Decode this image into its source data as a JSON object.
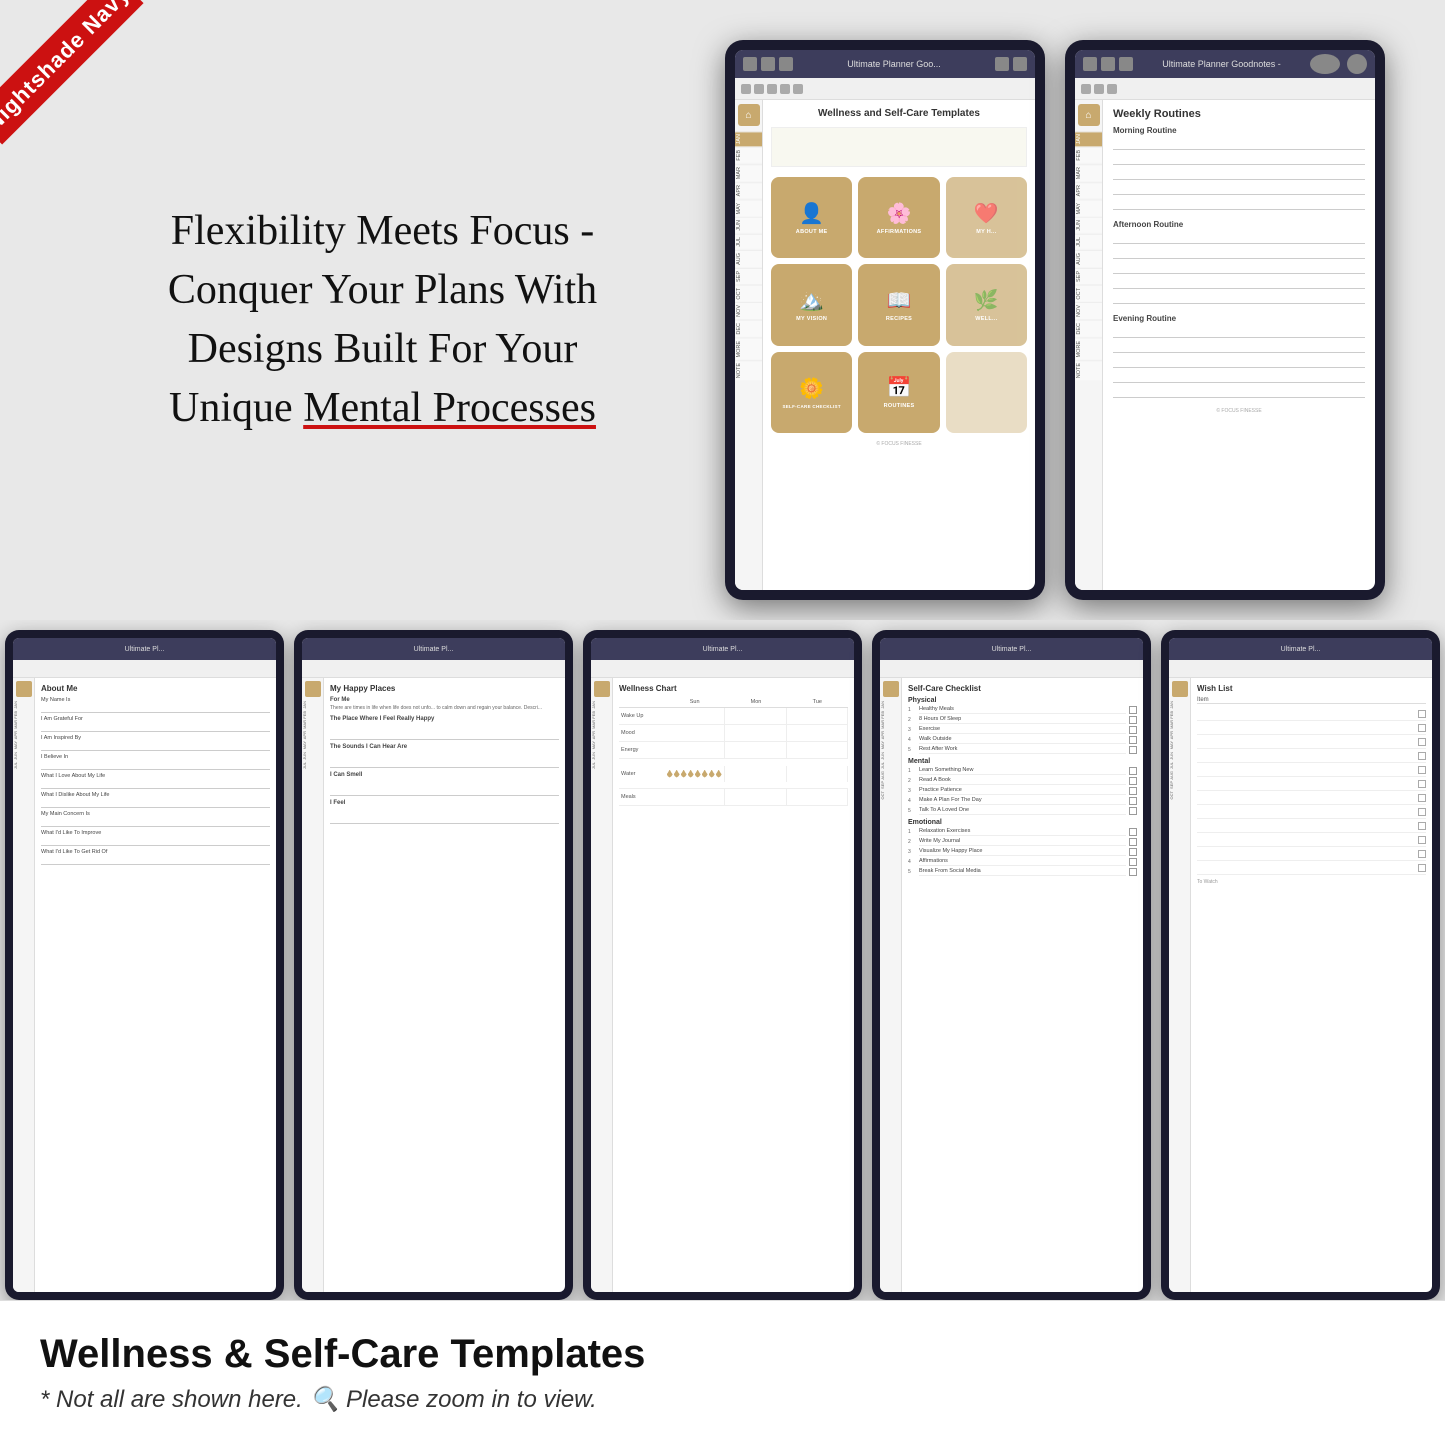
{
  "ribbon": {
    "text": "Nightshade Navy"
  },
  "headline": {
    "line1": "Flexibility Meets Focus -",
    "line2": "Conquer Your Plans With",
    "line3": "Designs Built For Your",
    "line4_part1": "Unique ",
    "line4_part2": "Mental Processes"
  },
  "tablet_left": {
    "topbar_title": "Ultimate Planner Goo...",
    "page_title": "Wellness and Self-Care Templates",
    "tiles": [
      {
        "label": "ABOUT ME",
        "icon": "👤"
      },
      {
        "label": "AFFIRMATIONS",
        "icon": "🌸"
      },
      {
        "label": "MY H...",
        "icon": "❤️"
      },
      {
        "label": "MY VISION",
        "icon": "🏔️"
      },
      {
        "label": "RECIPES",
        "icon": "📖"
      },
      {
        "label": "WELL...",
        "icon": "🌿"
      },
      {
        "label": "SELF-CARE CHECKLIST",
        "icon": "🌼"
      },
      {
        "label": "ROUTINES",
        "icon": "📅"
      },
      {
        "label": "",
        "icon": ""
      }
    ],
    "months": [
      "JAN",
      "FEB",
      "MAR",
      "APR",
      "MAY",
      "JUN",
      "JUL",
      "AUG",
      "SEP",
      "OCT",
      "NOV",
      "DEC",
      "MORE",
      "NOTE"
    ]
  },
  "tablet_right": {
    "topbar_title": "Ultimate Planner Goodnotes -",
    "page_title": "Weekly Routines",
    "sections": [
      {
        "title": "Morning Routine",
        "lines": 4
      },
      {
        "title": "Afternoon Routine",
        "lines": 4
      },
      {
        "title": "Evening Routine",
        "lines": 4
      }
    ],
    "months": [
      "JAN",
      "FEB",
      "MAR",
      "APR",
      "MAY",
      "JUN",
      "JUL",
      "AUG",
      "SEP",
      "OCT",
      "NOV",
      "DEC",
      "MORE",
      "NOTE"
    ]
  },
  "bottom_tablets": [
    {
      "title": "About Me",
      "fields": [
        "My Name Is",
        "I Am Grateful For",
        "I Am Inspired By",
        "I Believe In",
        "What I Love About My Life",
        "What I Dislike About My Life",
        "My Main Concern Is",
        "What I'd Like To Improve",
        "What I'd Like To Get Rid Of"
      ]
    },
    {
      "title": "My Happy Places",
      "sections": [
        {
          "heading": "For Me",
          "text": "There are times in life when life does not unfo... to calm down and regain your balance. Descri..."
        },
        {
          "heading": "The Place Where I Feel Really Happy"
        },
        {
          "heading": "The Sounds I Can Hear Are"
        },
        {
          "heading": "I Can Smell"
        },
        {
          "heading": "I Feel"
        }
      ]
    },
    {
      "title": "Wellness Chart",
      "cols": [
        "Sun",
        "Mon",
        "Tue"
      ],
      "rows": [
        {
          "label": "Wake Up",
          "type": "lines"
        },
        {
          "label": "Mood",
          "type": "lines"
        },
        {
          "label": "Energy",
          "type": "lines"
        },
        {
          "label": "Water",
          "type": "drops"
        },
        {
          "label": "Meals",
          "type": "lines"
        }
      ]
    },
    {
      "title": "Self-Care Checklist",
      "sections": [
        {
          "title": "Physical",
          "items": [
            "Healthy Meals",
            "8 Hours Of Sleep",
            "Exercise",
            "Walk Outside",
            "Rest After Work"
          ]
        },
        {
          "title": "Mental",
          "items": [
            "Learn Something New",
            "Read A Book",
            "Practice Patience",
            "Make A Plan For The Day",
            "Talk To A Loved One"
          ]
        },
        {
          "title": "Emotional",
          "items": [
            "Relaxation Exercises",
            "Write My Journal",
            "Visualize My Happy Place",
            "Affirmations",
            "Break From Social Media"
          ]
        }
      ]
    },
    {
      "title": "Wish List",
      "col_headers": [
        "Item",
        ""
      ],
      "rows": [
        "",
        "",
        "",
        "",
        "",
        "",
        "",
        "",
        "",
        "",
        "",
        "",
        "",
        "",
        "",
        "",
        "",
        "",
        "",
        ""
      ]
    }
  ],
  "bottom_text": {
    "main_title": "Wellness & Self-Care Templates",
    "sub_text": "* Not all are shown here.",
    "sub_text2": "Please zoom in to view."
  },
  "colors": {
    "accent_gold": "#c8a96e",
    "dark_navy": "#1a1a2e",
    "ribbon_red": "#cc1111"
  }
}
